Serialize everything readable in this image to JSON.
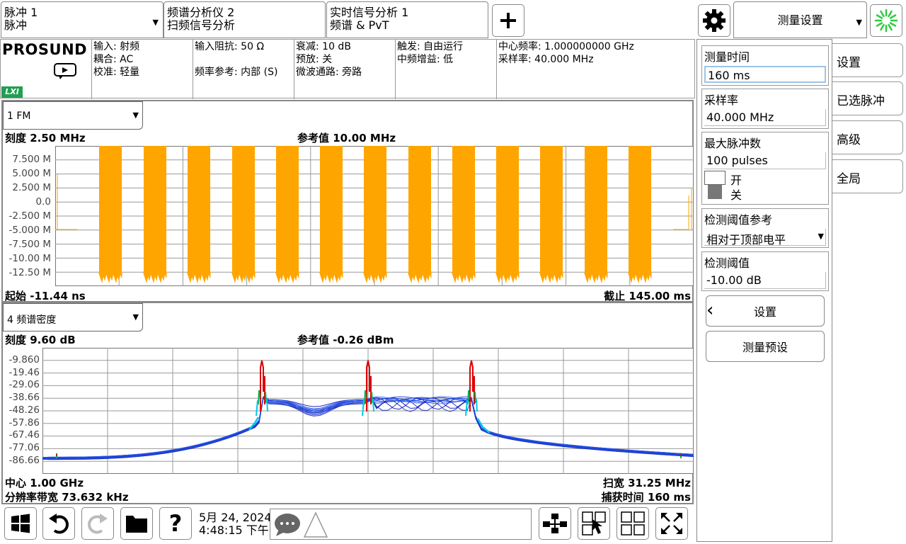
{
  "tabs": [
    {
      "line1": "脉冲 1",
      "line2": "脉冲",
      "dropdown": true
    },
    {
      "line1": "频谱分析仪 2",
      "line2": "扫频信号分析"
    },
    {
      "line1": "实时信号分析 1",
      "line2": "频谱 & PvT"
    }
  ],
  "toolbar": {
    "add_icon": "plus-icon",
    "settings_icon": "gear-icon",
    "menu_select": "测量设置",
    "busy_icon": "spinner-icon",
    "busy_color": "#2ecc40"
  },
  "info": {
    "brand": "PROSUND",
    "lxi": "LXI",
    "col1": [
      "输入: 射频",
      "耦合: AC",
      "校准: 轻量"
    ],
    "col2": [
      "输入阻抗: 50 Ω",
      "",
      "频率参考: 内部 (S)"
    ],
    "col3": [
      "衰减: 10 dB",
      "预放: 关",
      "微波通路: 旁路"
    ],
    "col4": [
      "触发: 自由运行",
      "中频增益: 低"
    ],
    "col5": [
      "中心频率: 1.000000000 GHz",
      "采样率: 40.000 MHz"
    ]
  },
  "panel1": {
    "selector": "1 FM",
    "scale": "刻度 2.50 MHz",
    "ref": "参考值 10.00 MHz",
    "start": "起始 -11.44 ns",
    "stop": "截止 145.00 ms",
    "yticks": [
      "7.500 M",
      "5.000 M",
      "2.500 M",
      "0.0",
      "-2.500 M",
      "-5.000 M",
      "-7.500 M",
      "-10.00 M",
      "-12.50 M"
    ],
    "trace_color": "#ffa500"
  },
  "panel2": {
    "selector": "4 频谱密度",
    "scale": "刻度 9.60 dB",
    "ref": "参考值 -0.26 dBm",
    "center": "中心 1.00 GHz",
    "rbw": "分辨率带宽 73.632 kHz",
    "span": "扫宽 31.25 MHz",
    "acq": "捕获时间 160 ms",
    "yticks": [
      "-9.860",
      "-19.46",
      "-29.06",
      "-38.66",
      "-48.26",
      "-57.86",
      "-67.46",
      "-77.06",
      "-86.66"
    ]
  },
  "settings": {
    "meas_time_label": "测量时间",
    "meas_time_value": "160 ms",
    "sample_rate_label": "采样率",
    "sample_rate_value": "40.000 MHz",
    "max_pulses_label": "最大脉冲数",
    "max_pulses_value": "100 pulses",
    "toggle_on": "开",
    "toggle_off": "关",
    "thresh_ref_label": "检测阈值参考",
    "thresh_ref_value": "相对于顶部电平",
    "thresh_label": "检测阈值",
    "thresh_value": "-10.00 dB",
    "back_button": "设置",
    "preset_button": "测量预设"
  },
  "side_tabs": [
    "设置",
    "已选脉冲",
    "高级",
    "全局"
  ],
  "bottom": {
    "date": "5月 24, 2024",
    "time": "4:48:15 下午",
    "icons": [
      "windows-icon",
      "undo-icon",
      "redo-icon",
      "folder-icon",
      "help-icon",
      "message-icon",
      "warning-icon",
      "layout-tree-icon",
      "touch-select-icon",
      "grid-icon",
      "fullscreen-icon"
    ]
  }
}
